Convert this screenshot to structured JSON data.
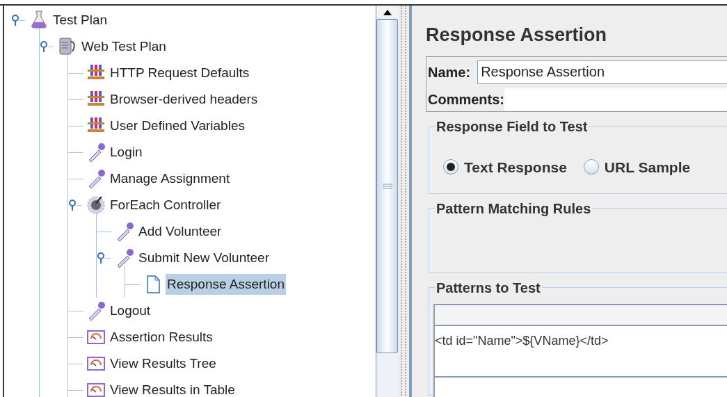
{
  "tree": [
    {
      "label": "Test Plan",
      "kind": "plan",
      "expanded": true,
      "selected": false,
      "children": [
        {
          "label": "Web Test Plan",
          "kind": "thread",
          "expanded": true,
          "selected": false,
          "children": [
            {
              "label": "HTTP Request Defaults",
              "kind": "config",
              "selected": false
            },
            {
              "label": "Browser-derived headers",
              "kind": "config",
              "selected": false
            },
            {
              "label": "User Defined Variables",
              "kind": "config",
              "selected": false
            },
            {
              "label": "Login",
              "kind": "sampler",
              "selected": false
            },
            {
              "label": "Manage Assignment",
              "kind": "sampler",
              "selected": false
            },
            {
              "label": "ForEach Controller",
              "kind": "controller",
              "expanded": true,
              "selected": false,
              "children": [
                {
                  "label": "Add Volunteer",
                  "kind": "sampler",
                  "selected": false
                },
                {
                  "label": "Submit New Volunteer",
                  "kind": "sampler",
                  "expanded": true,
                  "selected": false,
                  "children": [
                    {
                      "label": "Response Assertion",
                      "kind": "assertion",
                      "selected": true
                    }
                  ]
                }
              ]
            },
            {
              "label": "Logout",
              "kind": "sampler",
              "selected": false
            },
            {
              "label": "Assertion Results",
              "kind": "listener",
              "selected": false
            },
            {
              "label": "View Results Tree",
              "kind": "listener",
              "selected": false
            },
            {
              "label": "View Results in Table",
              "kind": "listener",
              "selected": false
            }
          ]
        }
      ]
    }
  ],
  "panel": {
    "title": "Response Assertion",
    "name": {
      "label": "Name:",
      "value": "Response Assertion"
    },
    "comments": {
      "label": "Comments:"
    },
    "response_field": {
      "title": "Response Field to Test",
      "options": [
        {
          "label": "Text Response",
          "selected": true
        },
        {
          "label": "URL Sample",
          "selected": false
        }
      ]
    },
    "pattern_matching": {
      "title": "Pattern Matching Rules"
    },
    "patterns": {
      "title": "Patterns to Test",
      "rows": [
        "<td id=\"Name\">${VName}</td>"
      ]
    }
  }
}
